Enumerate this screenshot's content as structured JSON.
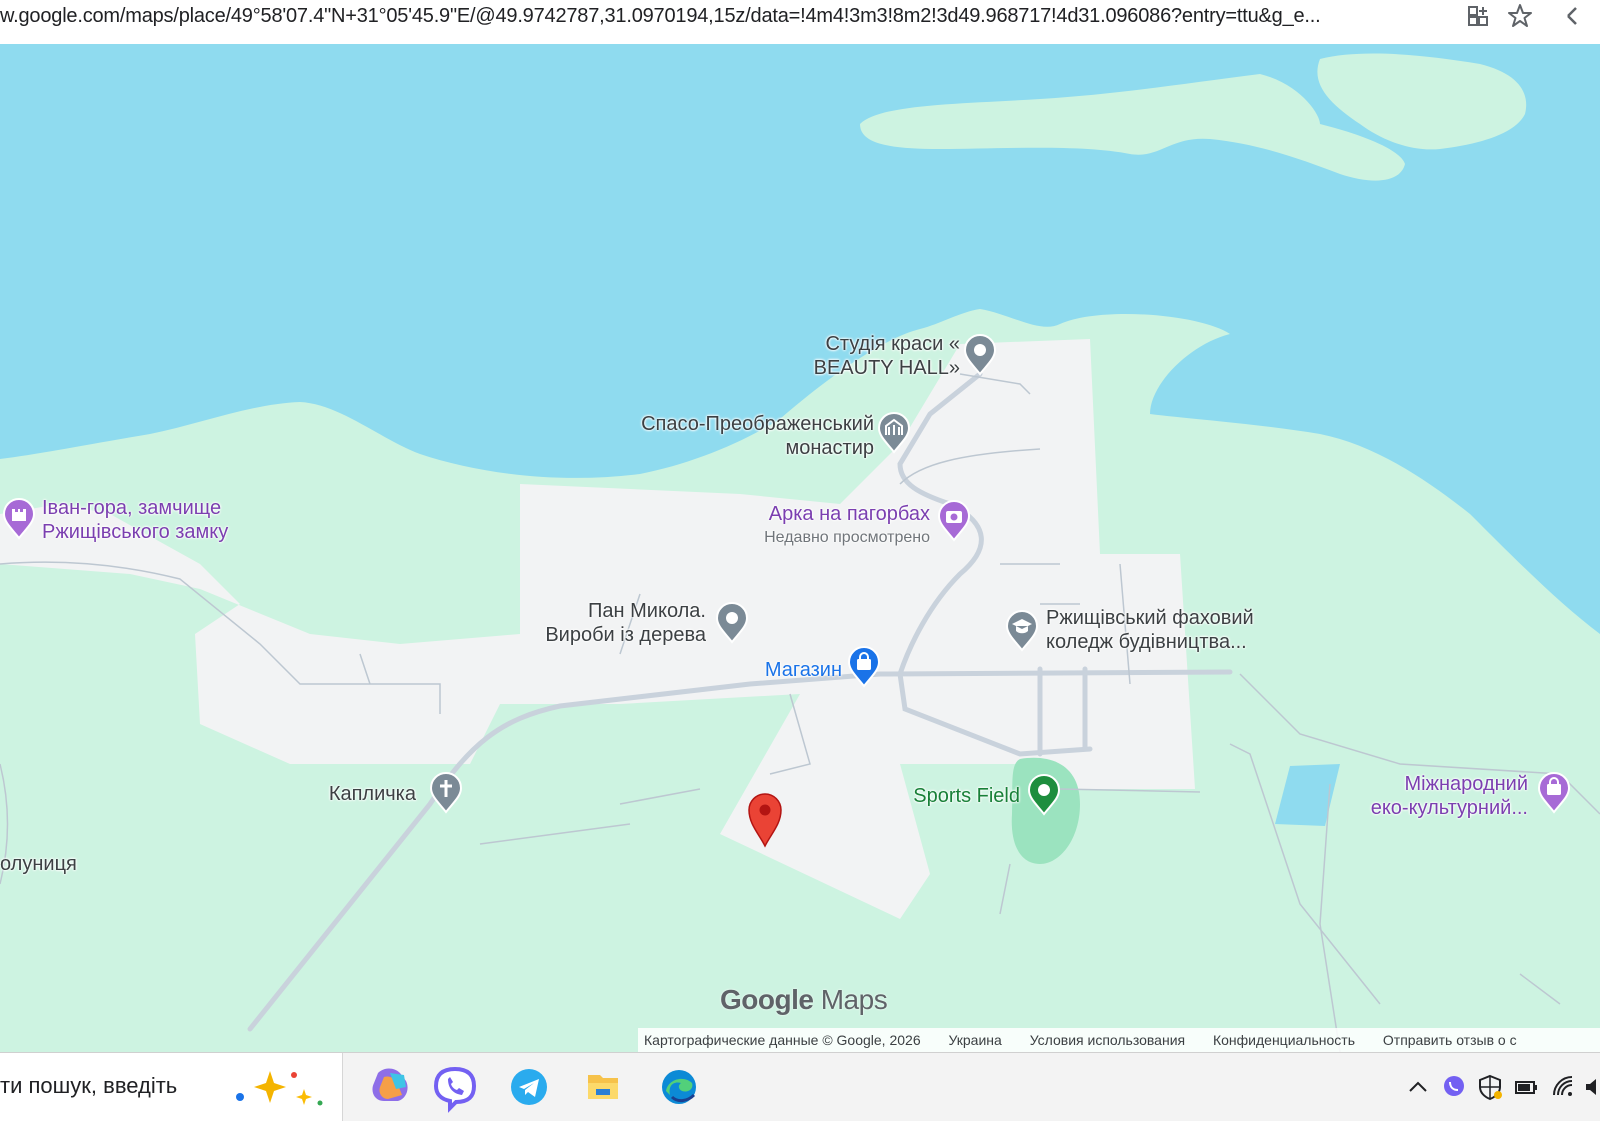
{
  "browser": {
    "url": "w.google.com/maps/place/49°58'07.4\"N+31°05'45.9\"E/@49.9742787,31.0970194,15z/data=!4m4!3m3!8m2!3d49.968717!4d31.096086?entry=ttu&g_e..."
  },
  "map": {
    "colors": {
      "water": "#8fdbef",
      "land": "#cdf3e1",
      "urban": "#f2f3f4",
      "road": "#c9d2dc",
      "marker": "#ea4335"
    },
    "pois": [
      {
        "id": "beauty-hall",
        "line1": "Студія краси «",
        "line2": "BEAUTY HALL»",
        "style": "gray",
        "icon": "pin-icon"
      },
      {
        "id": "monastery",
        "line1": "Спасо-Преображенський",
        "line2": "монастир",
        "style": "gray",
        "icon": "temple-icon"
      },
      {
        "id": "ivan-gora",
        "line1": "Іван-гора, замчище",
        "line2": "Ржищівського замку",
        "style": "purple",
        "icon": "castle-icon"
      },
      {
        "id": "arka",
        "line1": "Арка на пагорбах",
        "sub": "Недавно просмотрено",
        "style": "purple",
        "icon": "camera-icon"
      },
      {
        "id": "pan-mykola",
        "line1": "Пан Микола.",
        "line2": "Вироби із дерева",
        "style": "gray",
        "icon": "pin-icon"
      },
      {
        "id": "college",
        "line1": "Ржищівський фаховий",
        "line2": "коледж будівництва...",
        "style": "gray",
        "icon": "school-icon"
      },
      {
        "id": "shop",
        "line1": "Магазин",
        "style": "blue",
        "icon": "shopping-bag-icon"
      },
      {
        "id": "chapel",
        "line1": "Капличка",
        "style": "gray",
        "icon": "cross-icon"
      },
      {
        "id": "sports-field",
        "line1": "Sports Field",
        "style": "green",
        "icon": "park-icon"
      },
      {
        "id": "eco",
        "line1": "Міжнародний",
        "line2": "еко-культурний...",
        "style": "purple",
        "icon": "museum-icon"
      },
      {
        "id": "edge-label",
        "line1": "олуниця",
        "style": "gray"
      }
    ],
    "logo": {
      "google": "Google",
      "maps": "Maps"
    },
    "footer": [
      "Картографические данные © Google, 2026",
      "Украина",
      "Условия использования",
      "Конфиденциальность",
      "Отправить отзыв о с"
    ]
  },
  "taskbar": {
    "search_text": "ти пошук, введіть",
    "apps": [
      "copilot-icon",
      "viber-icon",
      "telegram-icon",
      "file-explorer-icon",
      "edge-icon"
    ]
  }
}
